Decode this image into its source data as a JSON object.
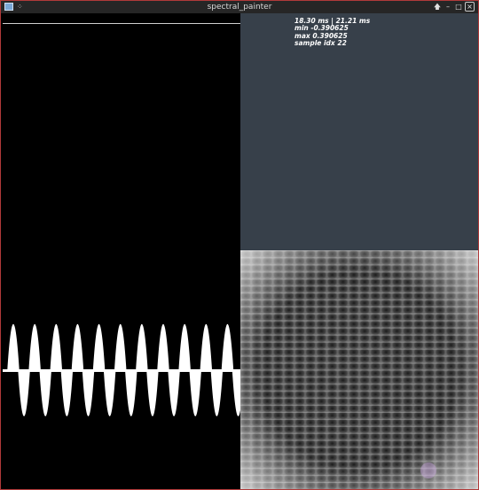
{
  "window": {
    "title": "spectral_painter",
    "title_buttons": {
      "keep_above": "🡅",
      "minimize": "–",
      "maximize": "□",
      "close": "×"
    }
  },
  "stats": {
    "timing": "18.30 ms | 21.21 ms",
    "min": "min -0.390625",
    "max": "max 0.390625",
    "sample": "sample idx 22"
  },
  "waveform": {
    "peaks_visible": 11,
    "amplitude": 0.390625
  },
  "colors": {
    "info_background": "#37404a",
    "window_border": "#b03a3a",
    "spectrogram_background": "#f4f4f4"
  }
}
